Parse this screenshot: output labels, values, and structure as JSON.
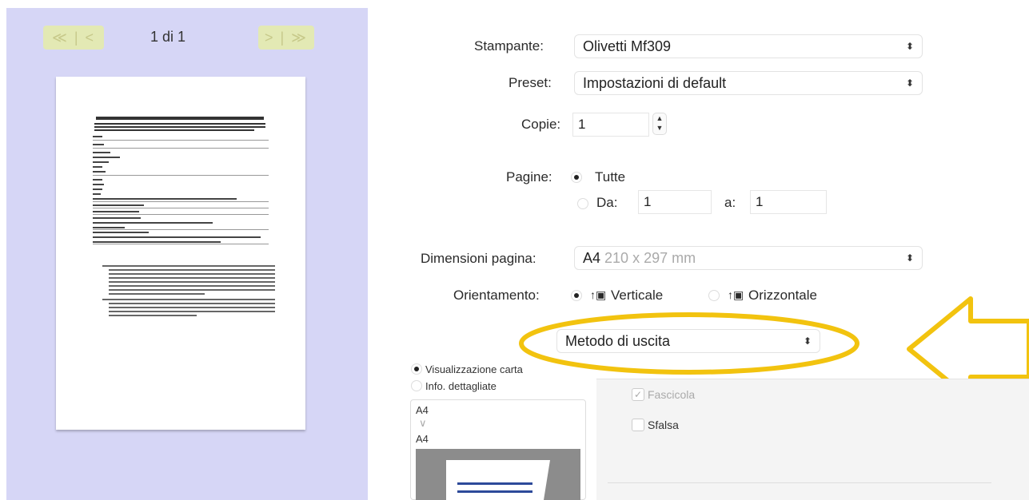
{
  "preview": {
    "prev_glyph": "≪ | <",
    "next_glyph": "> | ≫",
    "page_counter": "1 di 1"
  },
  "printer": {
    "label": "Stampante:",
    "value": "Olivetti Mf309"
  },
  "preset": {
    "label": "Preset:",
    "value": "Impostazioni di default"
  },
  "copies": {
    "label": "Copie:",
    "value": "1"
  },
  "pages": {
    "label": "Pagine:",
    "all_label": "Tutte",
    "range_label": "Da:",
    "from_value": "1",
    "to_label": "a:",
    "to_value": "1"
  },
  "page_size": {
    "label": "Dimensioni pagina:",
    "name": "A4",
    "dims": "210 x 297 mm"
  },
  "orientation": {
    "label": "Orientamento:",
    "portrait_label": "Verticale",
    "landscape_label": "Orizzontale"
  },
  "output_method": {
    "value": "Metodo di uscita"
  },
  "view_options": {
    "paper_view": "Visualizzazione carta",
    "details": "Info. dettagliate",
    "size_top": "A4",
    "size_arrow": "∨",
    "size_bottom": "A4"
  },
  "finishing": {
    "collate_label": "Fascicola",
    "offset_label": "Sfalsa"
  },
  "icons": {
    "chevron": "up-down-chevron-icon",
    "check": "checkmark-icon"
  },
  "colors": {
    "annotation": "#f2c30f",
    "preview_bg": "#d6d6f6",
    "nav_bg": "#e3e9b4",
    "paper_blue": "#2d4a9a"
  }
}
